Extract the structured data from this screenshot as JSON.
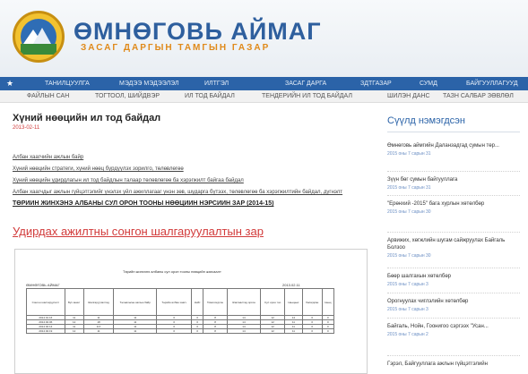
{
  "header": {
    "title": "ӨМНӨГОВЬ АЙМАГ",
    "subtitle": "ЗАСАГ ДАРГЫН ТАМГЫН ГАЗАР",
    "logo_icon": "emblem-icon"
  },
  "nav": {
    "home_icon": "home-icon",
    "items": [
      "ТАНИЛЦУУЛГА",
      "МЭДЭЭ МЭДЭЭЛЭЛ",
      "ИЛТГЭЛ",
      "ЗАСАГ ДАРГА",
      "ЗДТГАЗАР",
      "СУМД",
      "БАЙГУУЛЛАГУУД"
    ],
    "sub_items": [
      "ФАЙЛЫН САН",
      "ТОГТООЛ, ШИЙДВЭР",
      "ИЛ ТОД БАЙДАЛ",
      "ТЕНДЕРИЙН ИЛ ТОД БАЙДАЛ",
      "ШИЛЭН ДАНС",
      "ТАЗН САЛБАР ЗӨВЛӨЛ"
    ]
  },
  "post": {
    "title": "Хүний нөөцийн ил тод байдал",
    "date": "2013-02-11",
    "links": [
      "Албан хаагчийн ажлын байр",
      "Хүний нөөцийн стратеги, хүний нөөц бүрдүүлэх зорилго, төлөвлөгөө",
      "Хүний нөөцийн удирдлагын ил тод байдлын талаар төлөвлөгөө ба хэрэгжилт байгаа байдал",
      "Албан хаагчдыг ажлын гүйцэтгэлийг үнэлэх үйл ажиллагааг үнэн зөв, шударга бүтээх, төлөвлөгөө ба хэрэгжилтийн байдал, дүгнэлт",
      "ТӨРИЙН ЖИНХЭНЭ АЛБАНЫ СУЛ ОРОН ТООНЫ НӨӨЦИЙН НЭРСИЙН ЗАР (2014-15)"
    ],
    "headline": "Удирдах ажилтны сонгон шалгаруулалтын зар",
    "doc": {
      "caption": "Төрийн жинхэнэ албаны сул орон тооны нөөцийн жагсаалт",
      "org": "ӨМНӨГОВЬ АЙМАГ",
      "date": "2013.02.11",
      "headers": [
        "Сонгон шалгаруулалт",
        "Бүх анкет",
        "Шалгаруулалтад",
        "Төлөвлөсөн ажлын байр",
        "Төрийн албан хаагч",
        "Нийт",
        "Томилогдсон",
        "Жагсаалтад орсон",
        "Сул орон тоо",
        "Нөөцөөс",
        "Хасагдсан",
        "Нөөц"
      ],
      "rows": [
        [
          "2014.01.16",
          "11",
          "11",
          "11",
          "0",
          "0",
          "8",
          "14",
          "12",
          "14",
          "0",
          "0"
        ],
        [
          "2014.02.06",
          "12",
          "18",
          "11",
          "0",
          "0",
          "8",
          "14",
          "12",
          "11",
          "0",
          "0"
        ],
        [
          "2014.02.14",
          "11",
          "117",
          "11",
          "0",
          "0",
          "8",
          "14",
          "12",
          "11",
          "0",
          "0"
        ],
        [
          "2014.02.19",
          "12",
          "11",
          "11",
          "0",
          "0",
          "8",
          "14",
          "12",
          "11",
          "0",
          "0"
        ]
      ]
    }
  },
  "sidebar": {
    "title": "Сүүлд нэмэгдсэн",
    "items": [
      {
        "text": "Өмнөговь аймгийн Даланзадгад сумын төр...",
        "date": "2015 оны 7 сарын 31"
      },
      {
        "text": "Зүүн бөг сумын байгууллага",
        "date": "2015 оны 7 сарын 31"
      },
      {
        "text": "\"Ерөнхий -2015\" бага хурлын хөтөлбөр",
        "date": "2015 оны 7 сарын 30"
      },
      {
        "text": "Арвижих, хөгжлийн шугам сайжруулах Байгаль Болзоо",
        "date": "2015 оны 7 сарын 30"
      },
      {
        "text": "Бөөр шалгахын хөтөлбөр",
        "date": "2015 оны 7 сарын 3"
      },
      {
        "text": "Орогнуулах чиглэлийн хөтөлбөр",
        "date": "2015 оны 7 сарын 3"
      },
      {
        "text": "Байгаль, Нойн, Гоонигоо сэргээх \"Усан...",
        "date": "2015 оны 7 сарын 2"
      },
      {
        "text": "Гэрэл, Байгууллага ажлын гүйцэтгэлийн",
        "date": ""
      }
    ]
  }
}
